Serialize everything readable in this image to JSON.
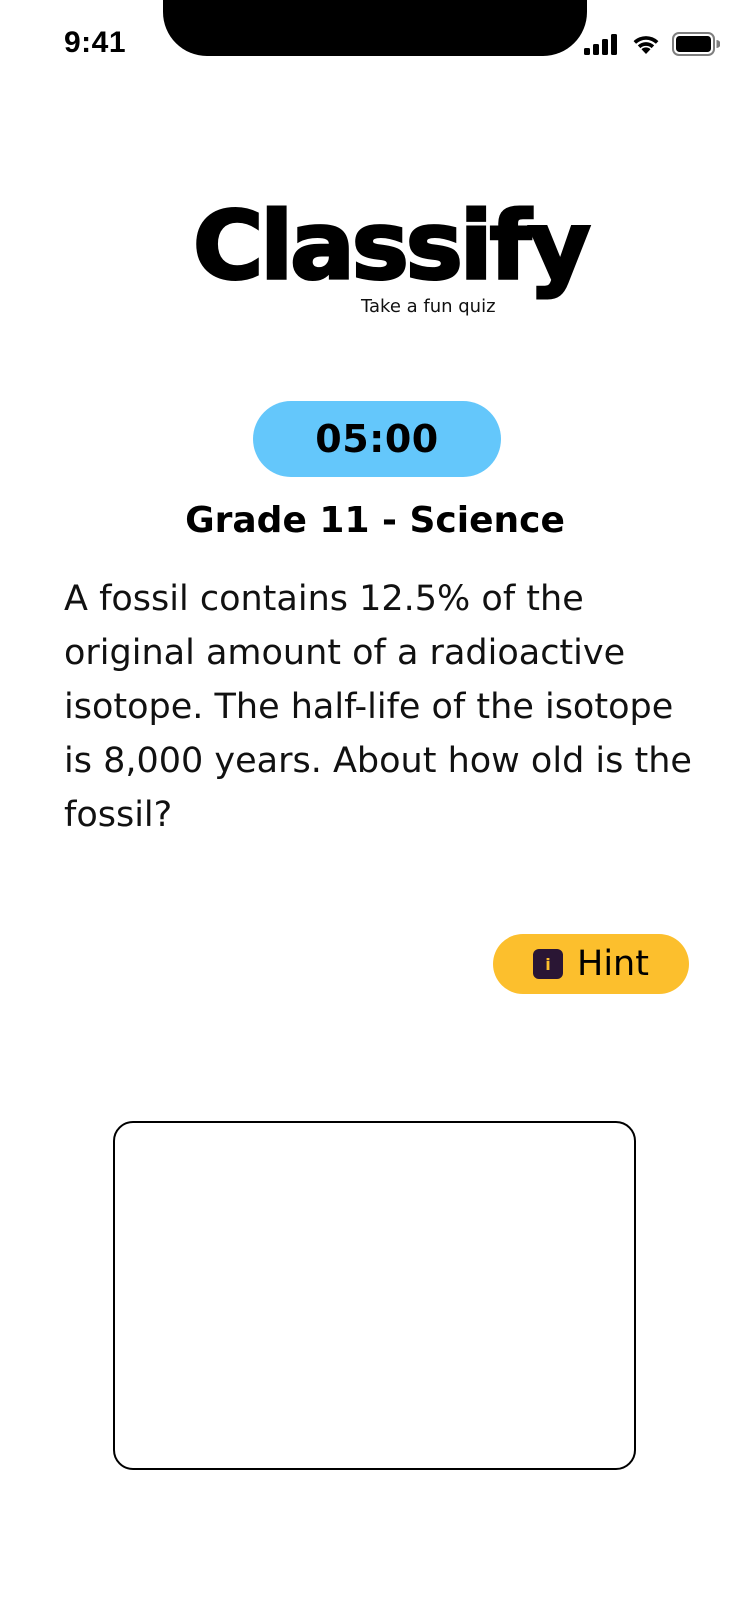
{
  "status_bar": {
    "time": "9:41",
    "icons": [
      "cellular-signal-icon",
      "wifi-icon",
      "battery-icon"
    ]
  },
  "app": {
    "logo": "Classify",
    "tagline": "Take a fun quiz"
  },
  "quiz": {
    "timer": "05:00",
    "subject": "Grade 11 - Science",
    "question": "A fossil contains 12.5% of the original amount of a radioactive isotope. The half-life of the isotope is 8,000 years. About how old is the fossil?",
    "hint_label": "Hint",
    "hint_icon_glyph": "i",
    "answer_value": ""
  },
  "colors": {
    "timer_bg": "#64c7fb",
    "hint_bg": "#fcbf2d",
    "hint_icon_bg": "#2a1634"
  }
}
